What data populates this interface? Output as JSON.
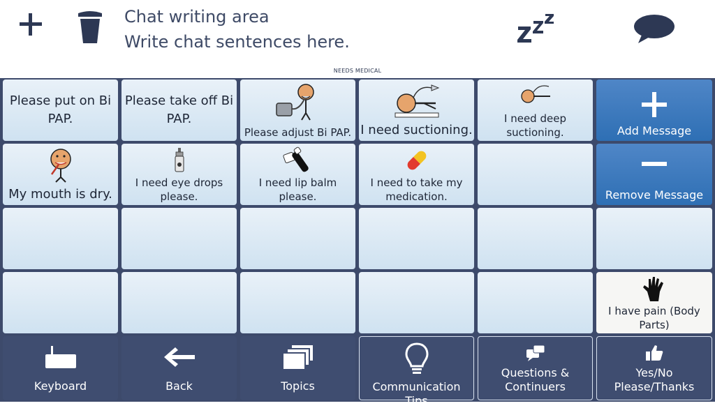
{
  "topbar": {
    "chat_title": "Chat writing area",
    "chat_placeholder": "Write chat sentences here."
  },
  "category_label": "NEEDS MEDICAL",
  "messages": [
    {
      "label": "Please put on Bi PAP."
    },
    {
      "label": "Please take off Bi PAP."
    },
    {
      "label": "Please adjust Bi PAP."
    },
    {
      "label": "I need suctioning."
    },
    {
      "label": "I need deep suctioning."
    },
    {
      "label": "My mouth is dry."
    },
    {
      "label": "I need eye drops please."
    },
    {
      "label": "I need lip balm please."
    },
    {
      "label": "I need to take my medication."
    },
    {
      "label": "I have pain (Body Parts)"
    }
  ],
  "actions": {
    "add": "Add Message",
    "remove": "Remove Message"
  },
  "nav": [
    {
      "label": "Keyboard"
    },
    {
      "label": "Back"
    },
    {
      "label": "Topics"
    },
    {
      "label": "Communication Tips"
    },
    {
      "label": "Questions & Continuers"
    },
    {
      "label": "Yes/No Please/Thanks"
    }
  ],
  "colors": {
    "frame": "#3d4a6b",
    "cell_light": "#dce9f5",
    "action_blue": "#3a78be",
    "nav_bg": "#3f4d70",
    "text_dark": "#1e2636"
  },
  "icons": [
    "plus-icon",
    "trash-icon",
    "sleep-icon",
    "speech-bubble-icon",
    "keyboard-icon",
    "back-arrow-icon",
    "topics-icon",
    "lightbulb-icon",
    "chat-bubbles-icon",
    "thumbs-up-icon"
  ]
}
